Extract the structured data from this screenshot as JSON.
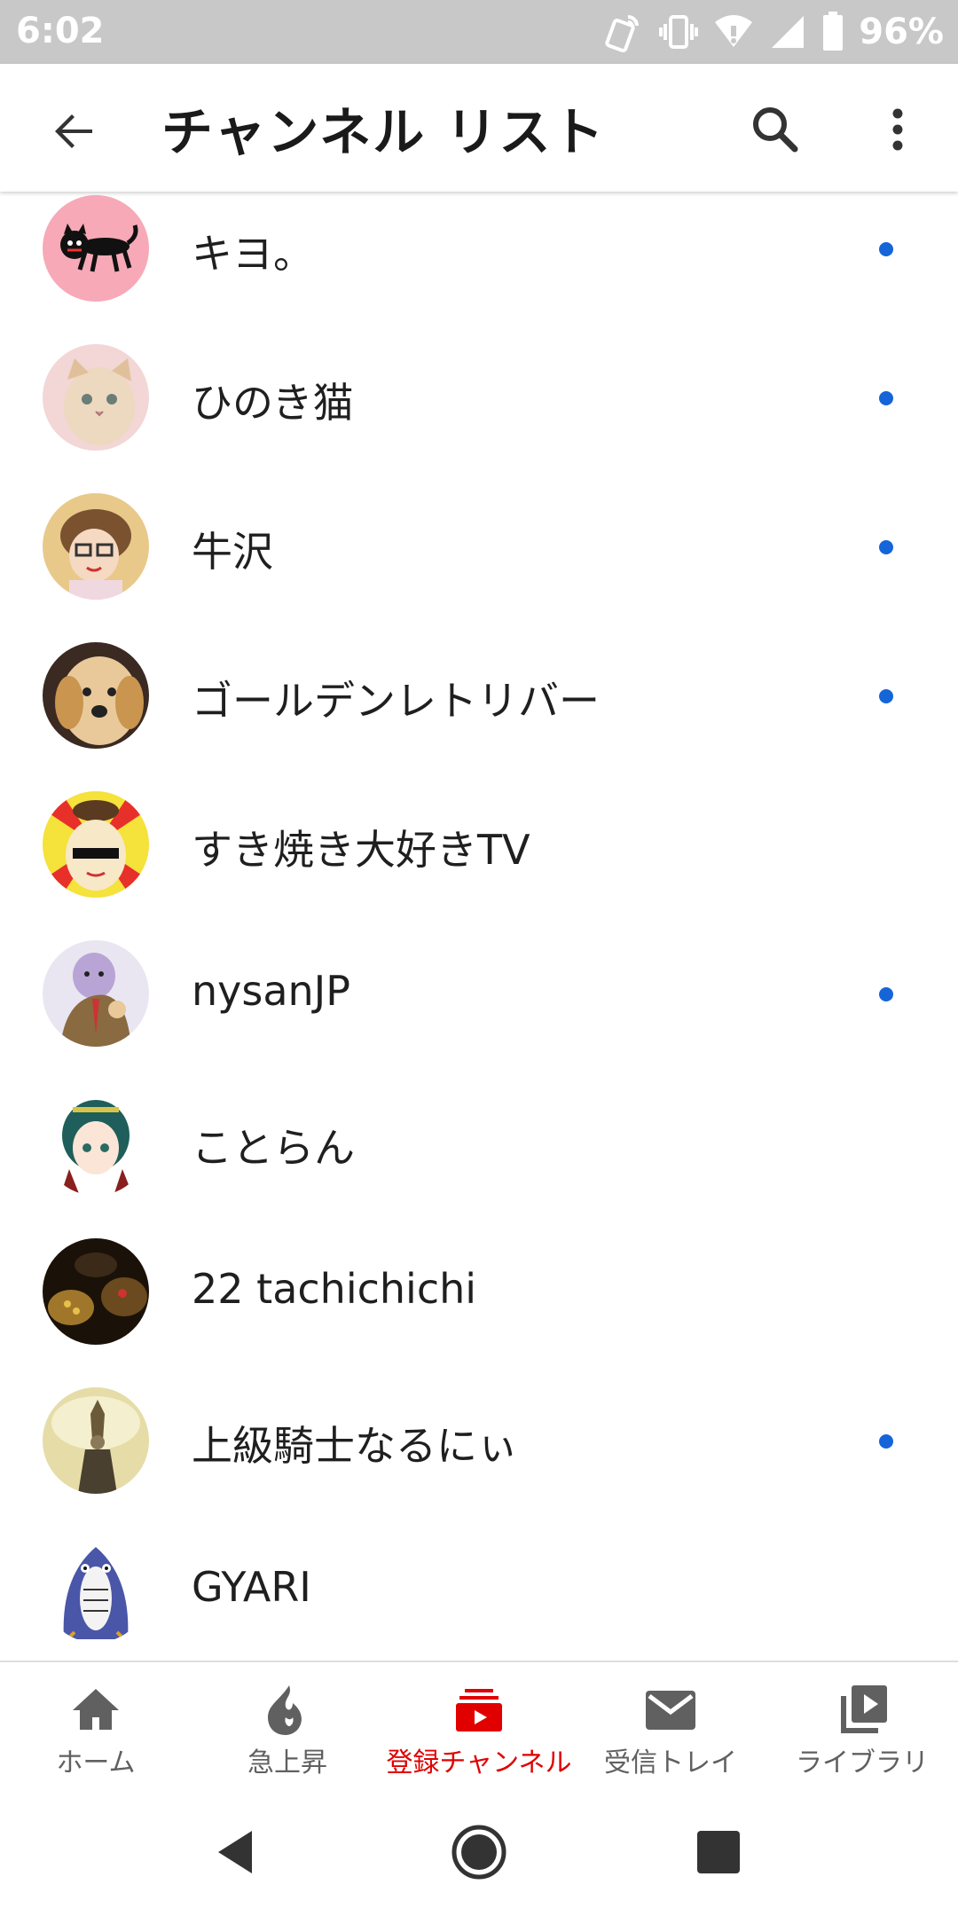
{
  "status_bar": {
    "time": "6:02",
    "battery": "96%"
  },
  "app_bar": {
    "title": "チャンネル リスト"
  },
  "channels": [
    {
      "name": "キヨ。",
      "new": true
    },
    {
      "name": "ひのき猫",
      "new": true
    },
    {
      "name": "牛沢",
      "new": true
    },
    {
      "name": "ゴールデンレトリバー",
      "new": true
    },
    {
      "name": "すき焼き大好きTV",
      "new": false
    },
    {
      "name": "nysanJP",
      "new": true
    },
    {
      "name": "ことらん",
      "new": false
    },
    {
      "name": "22 tachichichi",
      "new": false
    },
    {
      "name": "上級騎士なるにぃ",
      "new": true
    },
    {
      "name": "GYARI",
      "new": false
    }
  ],
  "bottom_nav": [
    {
      "label": "ホーム",
      "icon": "home-icon",
      "active": false
    },
    {
      "label": "急上昇",
      "icon": "trending-flame-icon",
      "active": false
    },
    {
      "label": "登録チャンネル",
      "icon": "subscriptions-icon",
      "active": true
    },
    {
      "label": "受信トレイ",
      "icon": "inbox-mail-icon",
      "active": false
    },
    {
      "label": "ライブラリ",
      "icon": "library-icon",
      "active": false
    }
  ],
  "colors": {
    "accent": "#e00000",
    "new_dot": "#1565d8",
    "status_bar": "#c8c8c8"
  }
}
